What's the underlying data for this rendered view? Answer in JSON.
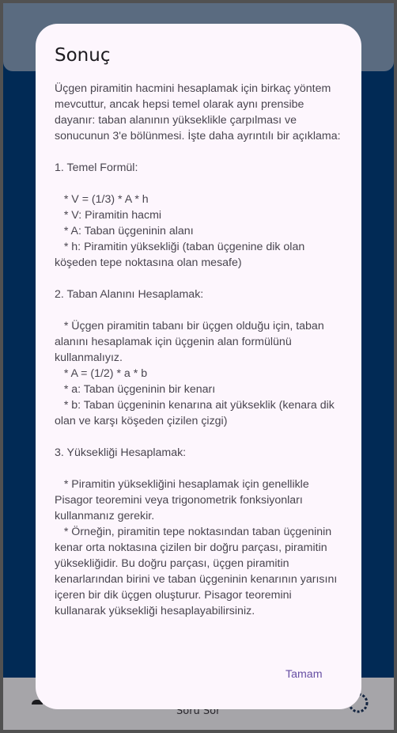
{
  "bottom_nav": {
    "ask_label": "Soru Sor"
  },
  "dialog": {
    "title": "Sonuç",
    "body": "Üçgen piramitin hacmini hesaplamak için birkaç yöntem mevcuttur, ancak hepsi temel olarak aynı prensibe dayanır: taban alanının yükseklikle çarpılması ve sonucunun 3'e bölünmesi. İşte daha ayrıntılı bir açıklama:\n\n1. Temel Formül:\n\n   * V = (1/3) * A * h\n   * V: Piramitin hacmi\n   * A: Taban üçgeninin alanı\n   * h: Piramitin yüksekliği (taban üçgenine dik olan köşeden tepe noktasına olan mesafe)\n\n2. Taban Alanını Hesaplamak:\n\n   * Üçgen piramitin tabanı bir üçgen olduğu için, taban alanını hesaplamak için üçgenin alan formülünü kullanmalıyız.\n   * A = (1/2) * a * b\n   * a: Taban üçgeninin bir kenarı\n   * b: Taban üçgeninin kenarına ait yükseklik (kenara dik olan ve karşı köşeden çizilen çizgi)\n\n3. Yüksekliği Hesaplamak:\n\n   * Piramitin yüksekliğini hesaplamak için genellikle Pisagor teoremini veya trigonometrik fonksiyonları kullanmanız gerekir.\n   * Örneğin, piramitin tepe noktasından taban üçgeninin kenar orta noktasına çizilen bir doğru parçası, piramitin yüksekliğidir. Bu doğru parçası, üçgen piramitin kenarlarından birini ve taban üçgeninin kenarının yarısını içeren bir dik üçgen oluşturur. Pisagor teoremini kullanarak yüksekliği hesaplayabilirsiniz.",
    "ok_label": "Tamam"
  },
  "colors": {
    "app_background": "#012a55",
    "dialog_surface": "#fdf6fd",
    "primary": "#6750a4"
  },
  "icons": {
    "bottom_left": "person-icon",
    "bottom_right": "spinner-icon"
  }
}
